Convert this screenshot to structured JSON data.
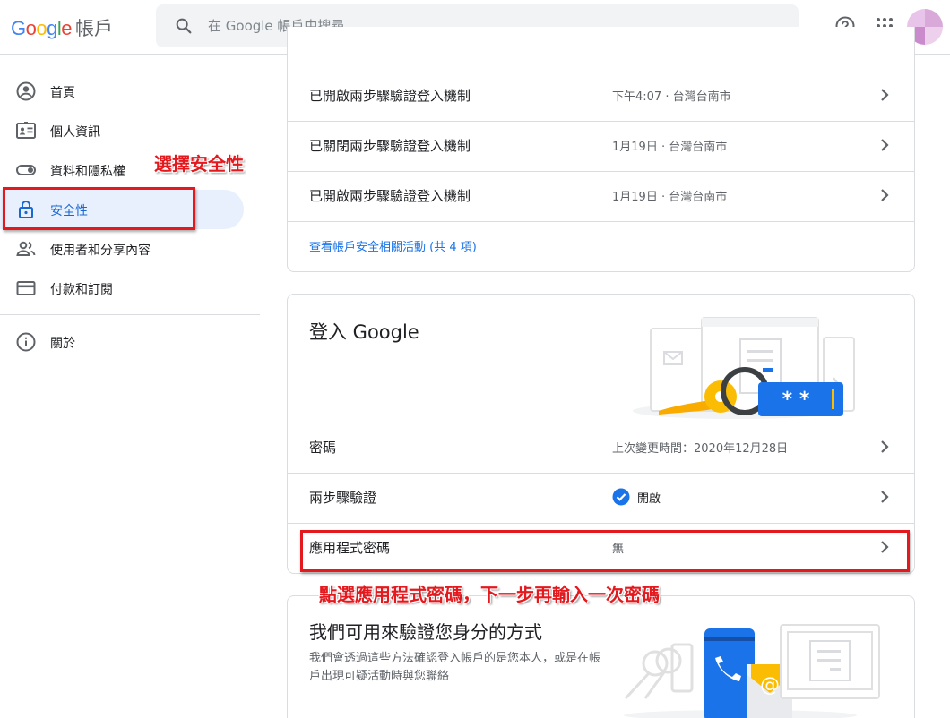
{
  "header": {
    "logo_google": "Google",
    "logo_product": "帳戶",
    "search_placeholder": "在 Google 帳戶中搜尋"
  },
  "sidebar": {
    "items": [
      {
        "label": "首頁",
        "icon": "account-circle-icon"
      },
      {
        "label": "個人資訊",
        "icon": "id-card-icon"
      },
      {
        "label": "資料和隱私權",
        "icon": "toggle-icon"
      },
      {
        "label": "安全性",
        "icon": "lock-icon"
      },
      {
        "label": "使用者和分享內容",
        "icon": "people-icon"
      },
      {
        "label": "付款和訂閱",
        "icon": "credit-card-icon"
      },
      {
        "label": "關於",
        "icon": "info-icon"
      }
    ]
  },
  "activity_card": {
    "rows": [
      {
        "label": "已開啟兩步驟驗證登入機制",
        "value": "下午4:07 · 台灣台南市"
      },
      {
        "label": "已關閉兩步驟驗證登入機制",
        "value": "1月19日 · 台灣台南市"
      },
      {
        "label": "已開啟兩步驟驗證登入機制",
        "value": "1月19日 · 台灣台南市"
      }
    ],
    "link": "查看帳戶安全相關活動 (共 4 項)"
  },
  "signin_card": {
    "title": "登入 Google",
    "illustration_password_mask": "* *",
    "rows": [
      {
        "label": "密碼",
        "value": "上次變更時間：2020年12月28日"
      },
      {
        "label": "兩步驟驗證",
        "value": "開啟"
      },
      {
        "label": "應用程式密碼",
        "value": "無"
      }
    ]
  },
  "verify_card": {
    "title": "我們可用來驗證您身分的方式",
    "desc": "我們會透過這些方法確認登入帳戶的是您本人，或是在帳戶出現可疑活動時與您聯絡"
  },
  "annotations": {
    "select_security": "選擇安全性",
    "click_app_password": "點選應用程式密碼，下一步再輸入一次密碼"
  },
  "colors": {
    "accent": "#1a73e8",
    "annotation": "#e3191e",
    "active_bg": "#e8f0fe"
  }
}
